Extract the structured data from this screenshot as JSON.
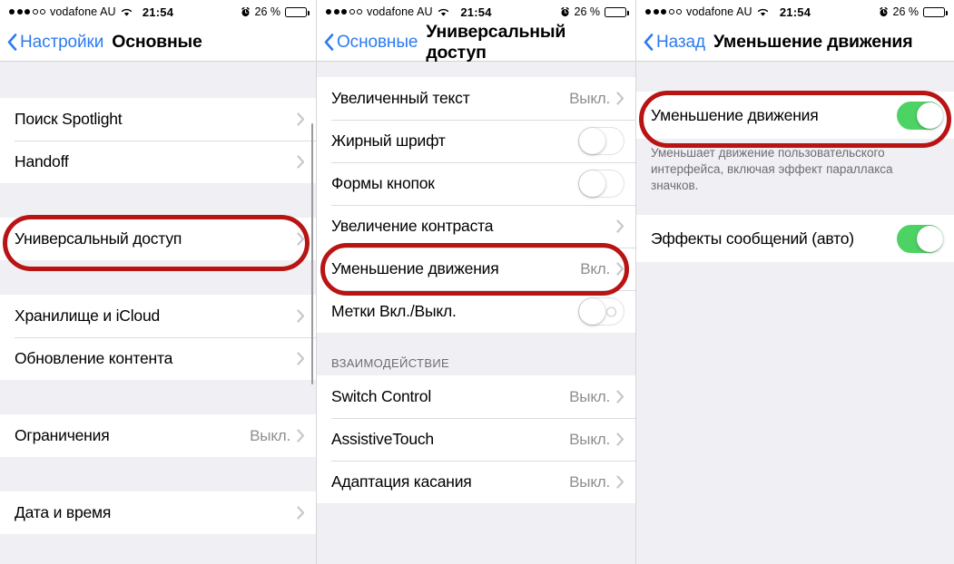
{
  "status_bar": {
    "signal_filled_dots": 3,
    "signal_empty_dots": 2,
    "carrier": "vodafone AU",
    "wifi_icon": "wifi-icon",
    "time": "21:54",
    "alarm_icon": "alarm-clock-icon",
    "battery_percent": "26 %",
    "battery_level": 26
  },
  "colors": {
    "accent_blue": "#2b7bf0",
    "toggle_on_green": "#4CD364",
    "annotation_red": "#B81414",
    "value_gray": "#8e8e93",
    "panel_bg": "#EFEFF4"
  },
  "panels": [
    {
      "id": "general-settings",
      "nav": {
        "back_icon": "chevron-left-icon",
        "back_label": "Настройки",
        "title": "Основные"
      },
      "rows": [
        {
          "label": "Поиск Spotlight",
          "value": "",
          "accessory": "chevron",
          "highlighted": false
        },
        {
          "label": "Handoff",
          "value": "",
          "accessory": "chevron",
          "highlighted": false
        },
        {
          "label": "Универсальный доступ",
          "value": "",
          "accessory": "chevron",
          "highlighted": true
        },
        {
          "label": "Хранилище и iCloud",
          "value": "",
          "accessory": "chevron",
          "highlighted": false
        },
        {
          "label": "Обновление контента",
          "value": "",
          "accessory": "chevron",
          "highlighted": false
        },
        {
          "label": "Ограничения",
          "value": "Выкл.",
          "accessory": "chevron",
          "highlighted": false
        },
        {
          "label": "Дата и время",
          "value": "",
          "accessory": "chevron",
          "highlighted": false
        }
      ]
    },
    {
      "id": "accessibility",
      "nav": {
        "back_icon": "chevron-left-icon",
        "back_label": "Основные",
        "title": "Универсальный доступ"
      },
      "rows": [
        {
          "label": "Увеличенный текст",
          "value": "Выкл.",
          "accessory": "chevron",
          "highlighted": false
        },
        {
          "label": "Жирный шрифт",
          "value": "",
          "accessory": "toggle-off",
          "highlighted": false
        },
        {
          "label": "Формы кнопок",
          "value": "",
          "accessory": "toggle-off",
          "highlighted": false
        },
        {
          "label": "Увеличение контраста",
          "value": "",
          "accessory": "chevron",
          "highlighted": false
        },
        {
          "label": "Уменьшение движения",
          "value": "Вкл.",
          "accessory": "chevron",
          "highlighted": true
        },
        {
          "label": "Метки Вкл./Выкл.",
          "value": "",
          "accessory": "toggle-off-labeled",
          "highlighted": false
        }
      ],
      "section_header": "ВЗАИМОДЕЙСТВИЕ",
      "section_rows": [
        {
          "label": "Switch Control",
          "value": "Выкл.",
          "accessory": "chevron",
          "highlighted": false
        },
        {
          "label": "AssistiveTouch",
          "value": "Выкл.",
          "accessory": "chevron",
          "highlighted": false
        },
        {
          "label": "Адаптация касания",
          "value": "Выкл.",
          "accessory": "chevron",
          "highlighted": false
        }
      ]
    },
    {
      "id": "reduce-motion",
      "nav": {
        "back_icon": "chevron-left-icon",
        "back_label": "Назад",
        "title": "Уменьшение движения"
      },
      "rows": [
        {
          "label": "Уменьшение движения",
          "value": "",
          "accessory": "toggle-on",
          "highlighted": true
        }
      ],
      "footnote": "Уменьшает движение пользовательского интерфейса, включая эффект параллакса значков.",
      "rows2": [
        {
          "label": "Эффекты сообщений (авто)",
          "value": "",
          "accessory": "toggle-on",
          "highlighted": false
        }
      ]
    }
  ]
}
